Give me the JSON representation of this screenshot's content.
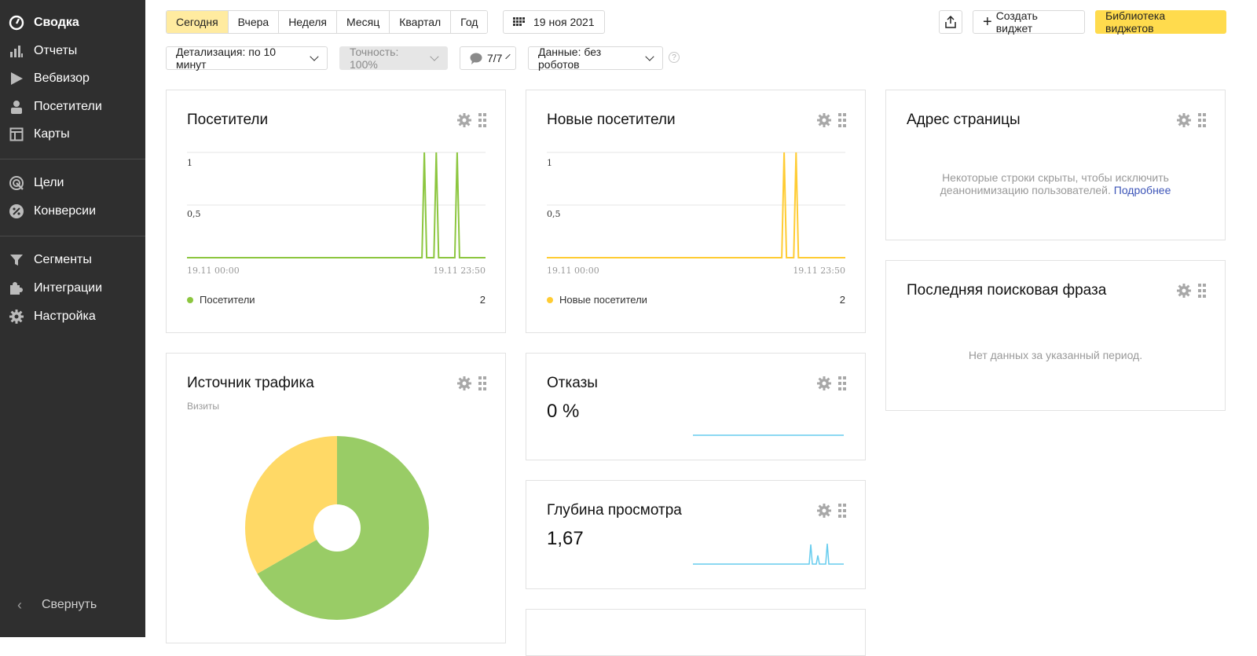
{
  "sidebar": {
    "items": [
      {
        "label": "Сводка",
        "icon": "dashboard-icon"
      },
      {
        "label": "Отчеты",
        "icon": "bar-chart-icon"
      },
      {
        "label": "Вебвизор",
        "icon": "play-icon"
      },
      {
        "label": "Посетители",
        "icon": "person-icon"
      },
      {
        "label": "Карты",
        "icon": "map-layout-icon"
      },
      {
        "label": "Цели",
        "icon": "target-icon"
      },
      {
        "label": "Конверсии",
        "icon": "percent-icon"
      },
      {
        "label": "Сегменты",
        "icon": "filter-icon"
      },
      {
        "label": "Интеграции",
        "icon": "puzzle-icon"
      },
      {
        "label": "Настройка",
        "icon": "gear-icon"
      }
    ],
    "collapse_label": "Свернуть"
  },
  "toolbar": {
    "periods": [
      "Сегодня",
      "Вчера",
      "Неделя",
      "Месяц",
      "Квартал",
      "Год"
    ],
    "selected_period": "Сегодня",
    "date": "19 ноя 2021",
    "create_widget": "Создать виджет",
    "library": "Библиотека виджетов",
    "detail": "Детализация: по 10 минут",
    "accuracy": "Точность: 100%",
    "segments": "7/7",
    "data_filter": "Данные: без роботов",
    "help": "?"
  },
  "colors": {
    "green": "#8cc63f",
    "yellow": "#ffcc33",
    "pie_green": "#99cc66",
    "pie_yellow": "#ffd966",
    "spark": "#66ccee",
    "active_tab": "#ffeba0",
    "primary_button": "#ffdb4d"
  },
  "widgets": {
    "visitors": {
      "title": "Посетители",
      "ticks_y": [
        "1",
        "0,5"
      ],
      "ticks_x": [
        "19.11 00:00",
        "19.11 23:50"
      ],
      "legend": "Посетители",
      "total": "2"
    },
    "new_visitors": {
      "title": "Новые посетители",
      "ticks_y": [
        "1",
        "0,5"
      ],
      "ticks_x": [
        "19.11 00:00",
        "19.11 23:50"
      ],
      "legend": "Новые посетители",
      "total": "2"
    },
    "page_address": {
      "title": "Адрес страницы",
      "message_line1": "Некоторые строки скрыты, чтобы исключить",
      "message_line2": "деанонимизацию пользователей.",
      "more_link": "Подробнее"
    },
    "search_phrase": {
      "title": "Последняя поисковая фраза",
      "message": "Нет данных за указанный период."
    },
    "traffic": {
      "title": "Источник трафика",
      "subtitle": "Визиты"
    },
    "bounces": {
      "title": "Отказы",
      "value": "0 %"
    },
    "depth": {
      "title": "Глубина просмотра",
      "value": "1,67"
    }
  },
  "chart_data": [
    {
      "type": "line",
      "title": "Посетители",
      "x_range": [
        "19.11 00:00",
        "19.11 23:50"
      ],
      "ylim": [
        0,
        1
      ],
      "grid": true,
      "series": [
        {
          "name": "Посетители",
          "spikes_at_fraction_of_day": [
            0.795,
            0.835,
            0.905
          ],
          "peak": 1,
          "total": 2
        }
      ]
    },
    {
      "type": "line",
      "title": "Новые посетители",
      "x_range": [
        "19.11 00:00",
        "19.11 23:50"
      ],
      "ylim": [
        0,
        1
      ],
      "grid": true,
      "series": [
        {
          "name": "Новые посетители",
          "spikes_at_fraction_of_day": [
            0.795,
            0.835
          ],
          "peak": 1,
          "total": 2
        }
      ]
    },
    {
      "type": "pie",
      "title": "Источник трафика",
      "subtitle": "Визиты",
      "slices": [
        {
          "value": 66.7,
          "color": "#99cc66"
        },
        {
          "value": 33.3,
          "color": "#ffd966"
        }
      ],
      "donut": true
    }
  ]
}
